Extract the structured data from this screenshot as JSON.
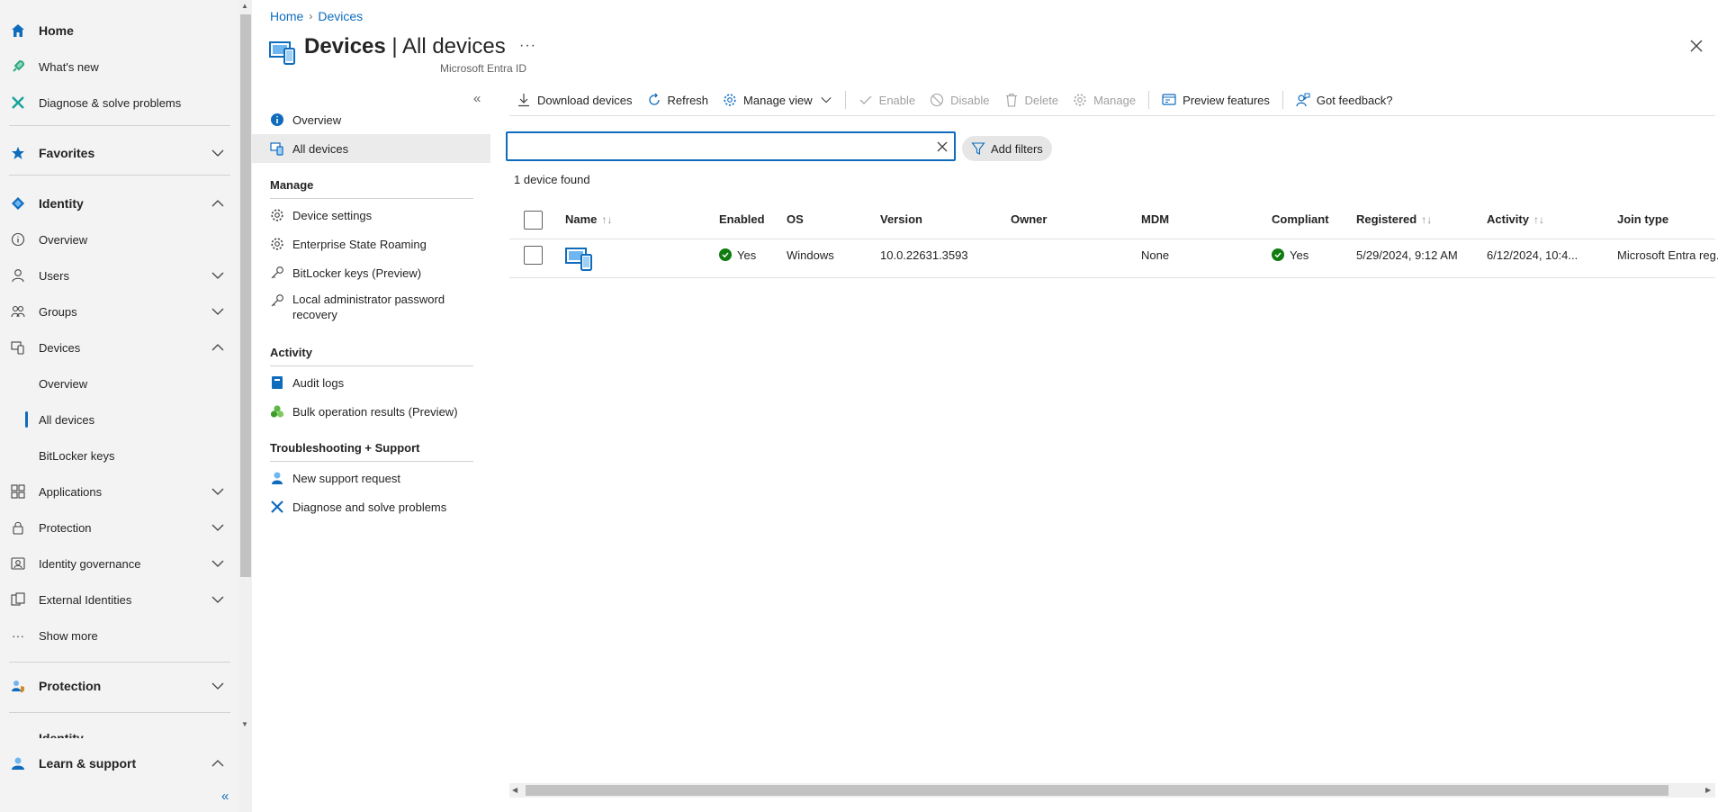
{
  "leftnav": {
    "home": "Home",
    "whats_new": "What's new",
    "diagnose": "Diagnose & solve problems",
    "favorites": "Favorites",
    "identity": "Identity",
    "overview": "Overview",
    "users": "Users",
    "groups": "Groups",
    "devices": "Devices",
    "devices_overview": "Overview",
    "all_devices": "All devices",
    "bitlocker_keys": "BitLocker keys",
    "applications": "Applications",
    "protection": "Protection",
    "identity_governance": "Identity governance",
    "external_identities": "External Identities",
    "show_more": "Show more",
    "protection_section": "Protection",
    "identity_partial": "Identity",
    "learn_support": "Learn & support"
  },
  "breadcrumb": {
    "home": "Home",
    "devices": "Devices"
  },
  "header": {
    "title_bold": "Devices",
    "title_rest": " | All devices",
    "subtitle": "Microsoft Entra ID",
    "more": "···"
  },
  "resource_menu": {
    "overview": "Overview",
    "all_devices": "All devices",
    "manage_section": "Manage",
    "device_settings": "Device settings",
    "enterprise_state_roaming": "Enterprise State Roaming",
    "bitlocker_keys_preview": "BitLocker keys (Preview)",
    "local_admin_line1": "Local administrator password",
    "local_admin_line2": "recovery",
    "activity_section": "Activity",
    "audit_logs": "Audit logs",
    "bulk_operation": "Bulk operation results (Preview)",
    "troubleshooting_section": "Troubleshooting + Support",
    "new_support_request": "New support request",
    "diagnose_solve": "Diagnose and solve problems"
  },
  "toolbar": {
    "download_devices": "Download devices",
    "refresh": "Refresh",
    "manage_view": "Manage view",
    "enable": "Enable",
    "disable": "Disable",
    "delete": "Delete",
    "manage": "Manage",
    "preview_features": "Preview features",
    "got_feedback": "Got feedback?"
  },
  "search": {
    "value": "",
    "add_filters": "Add filters",
    "result_count": "1 device found"
  },
  "table": {
    "columns": [
      "Name",
      "Enabled",
      "OS",
      "Version",
      "Owner",
      "MDM",
      "Compliant",
      "Registered",
      "Activity",
      "Join type"
    ],
    "rows": [
      {
        "name": "",
        "enabled": "Yes",
        "os": "Windows",
        "version": "10.0.22631.3593",
        "owner": "",
        "mdm": "None",
        "compliant": "Yes",
        "registered": "5/29/2024, 9:12 AM",
        "activity": "6/12/2024, 10:4...",
        "join_type": "Microsoft Entra reg..."
      }
    ]
  },
  "colors": {
    "accent": "#0f6cbd",
    "success": "#107c10",
    "nav_bg": "#f3f3f3"
  }
}
